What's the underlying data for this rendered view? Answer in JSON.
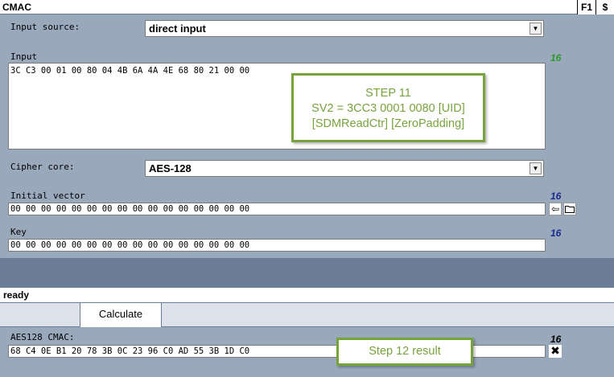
{
  "window": {
    "title": "CMAC",
    "help_label": "F1",
    "dollar_label": "$"
  },
  "input_source": {
    "label": "Input source:",
    "value": "direct input"
  },
  "input": {
    "label": "Input",
    "count": "16",
    "value": "3C C3 00 01 00 80 04 4B 6A 4A 4E 68 80 21 00 00"
  },
  "step11_note": {
    "line1": "STEP 11",
    "line2": "SV2 = 3CC3 0001 0080 [UID]",
    "line3": "[SDMReadCtr] [ZeroPadding]"
  },
  "cipher_core": {
    "label": "Cipher core:",
    "value": "AES-128"
  },
  "initial_vector": {
    "label": "Initial vector",
    "count": "16",
    "value": "00 00 00 00 00 00 00 00 00 00 00 00 00 00 00 00"
  },
  "key": {
    "label": "Key",
    "count": "16",
    "value": "00 00 00 00 00 00 00 00 00 00 00 00 00 00 00 00"
  },
  "status": {
    "text": "ready"
  },
  "toolbar": {
    "calculate_label": "Calculate"
  },
  "result": {
    "label": "AES128 CMAC:",
    "count": "16",
    "value": "68 C4 0E B1 20 78 3B 0C 23 96 C0 AD 55 3B 1D C0",
    "note": "Step 12 result"
  },
  "colors": {
    "panel_bg": "#9aa8bc",
    "band_bg": "#6b7d96",
    "note_green": "#77a33d",
    "count_green": "#2a9a2a",
    "count_navy": "#1a2a8c"
  },
  "icons": [
    "swap-left-icon",
    "folder-open-icon",
    "close-icon",
    "dropdown-arrow-icon"
  ]
}
